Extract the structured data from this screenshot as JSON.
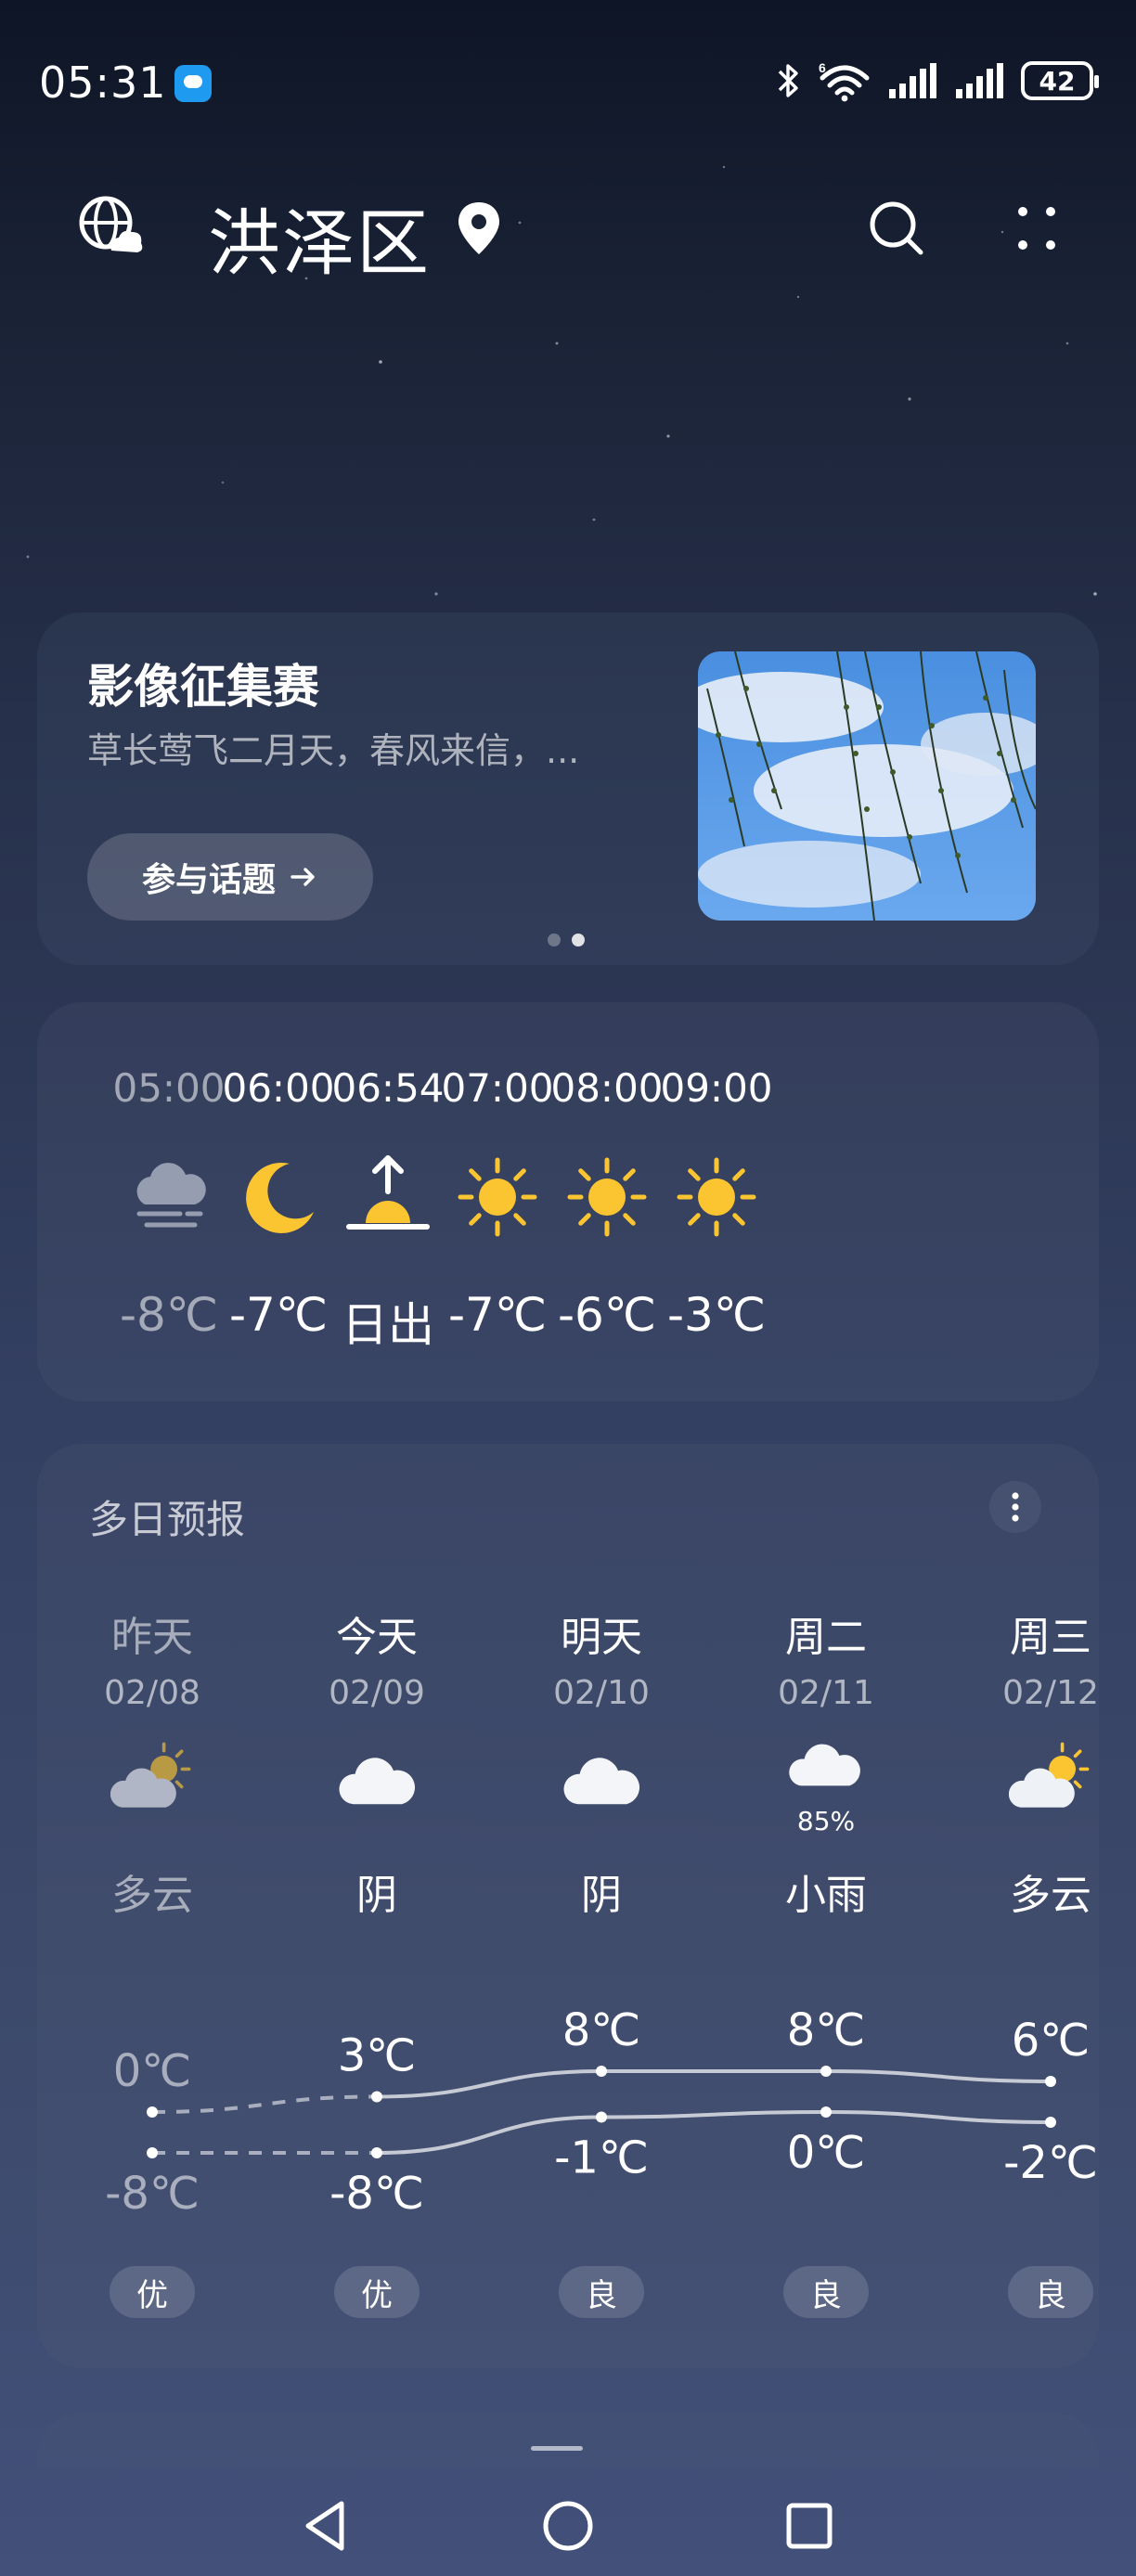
{
  "status": {
    "time": "05:31",
    "battery": "42"
  },
  "header": {
    "city": "洪泽区"
  },
  "promo": {
    "title": "影像征集赛",
    "subtitle": "草长莺飞二月天，春风来信，...",
    "button_label": "参与话题"
  },
  "hourly": [
    {
      "time": "05:00",
      "icon": "fog-cloud-icon",
      "temp": "-8℃"
    },
    {
      "time": "06:00",
      "icon": "moon-icon",
      "temp": "-7℃"
    },
    {
      "time": "06:54",
      "icon": "sunrise-icon",
      "temp": "日出"
    },
    {
      "time": "07:00",
      "icon": "sun-icon",
      "temp": "-7℃"
    },
    {
      "time": "08:00",
      "icon": "sun-icon",
      "temp": "-6℃"
    },
    {
      "time": "09:00",
      "icon": "sun-icon",
      "temp": "-3℃"
    }
  ],
  "daily": {
    "title": "多日预报",
    "days": [
      {
        "name": "昨天",
        "date": "02/08",
        "icon": "partly-cloudy-icon",
        "condition": "多云",
        "high": "0℃",
        "low": "-8℃",
        "aqi": "优",
        "past": true
      },
      {
        "name": "今天",
        "date": "02/09",
        "icon": "cloud-icon",
        "condition": "阴",
        "high": "3℃",
        "low": "-8℃",
        "aqi": "优",
        "past": false
      },
      {
        "name": "明天",
        "date": "02/10",
        "icon": "cloud-icon",
        "condition": "阴",
        "high": "8℃",
        "low": "-1℃",
        "aqi": "良",
        "past": false
      },
      {
        "name": "周二",
        "date": "02/11",
        "icon": "rain-icon",
        "pop": "85%",
        "condition": "小雨",
        "high": "8℃",
        "low": "0℃",
        "aqi": "良",
        "past": false
      },
      {
        "name": "周三",
        "date": "02/12",
        "icon": "partly-cloudy-icon",
        "condition": "多云",
        "high": "6℃",
        "low": "-2℃",
        "aqi": "良",
        "past": false
      }
    ]
  }
}
